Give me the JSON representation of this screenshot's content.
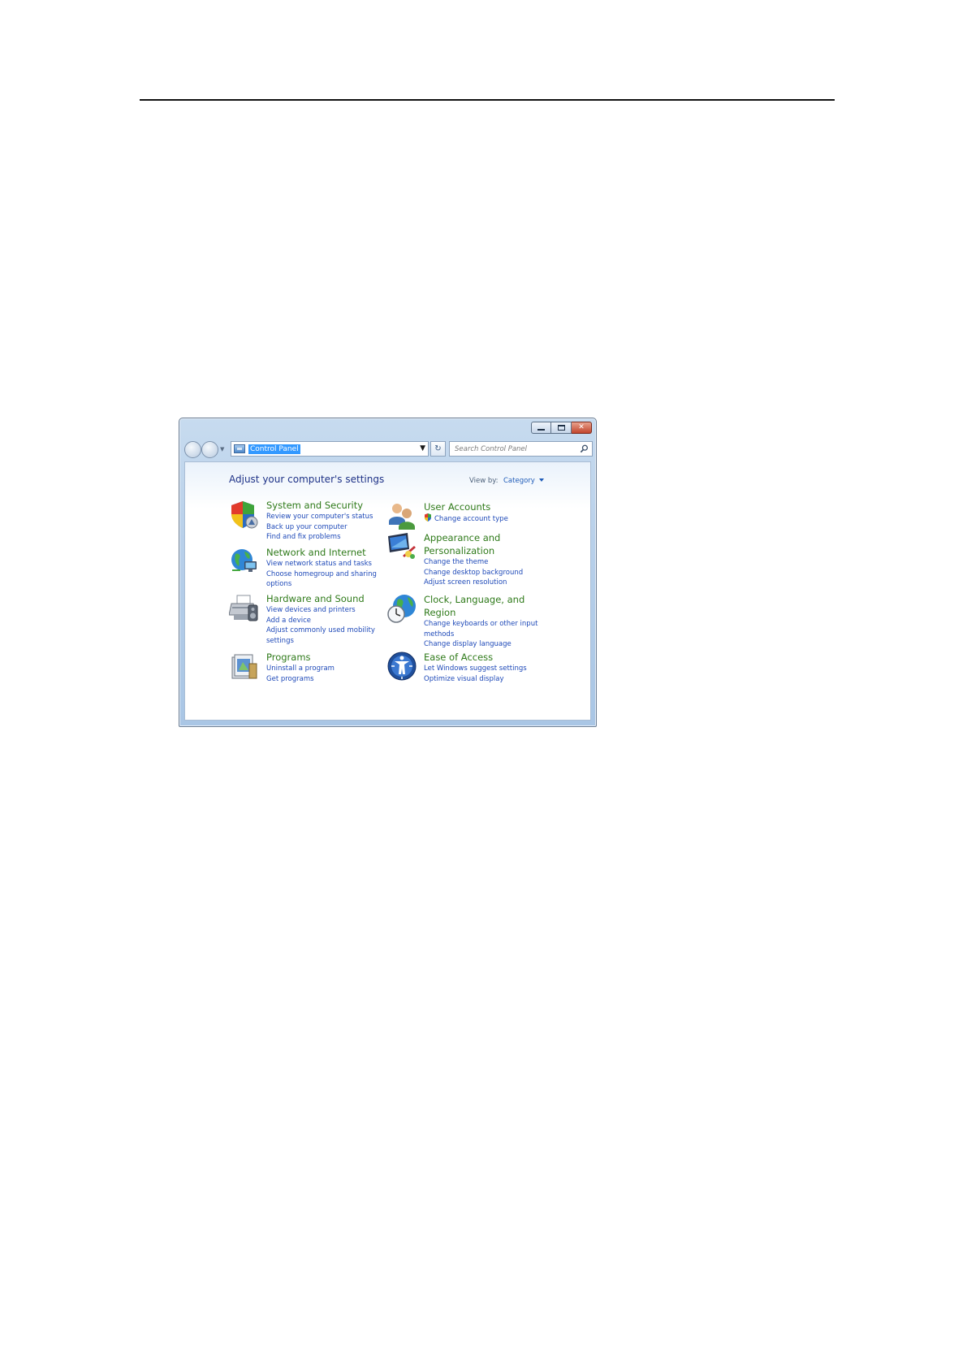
{
  "window": {
    "address": "Control Panel",
    "search_placeholder": "Search Control Panel",
    "refresh_glyph": "↻",
    "close_glyph": "✕"
  },
  "content": {
    "title": "Adjust your computer's settings",
    "viewby_label": "View by:",
    "viewby_value": "Category"
  },
  "categories": {
    "system_security": {
      "title": "System and Security",
      "links": [
        "Review your computer's status",
        "Back up your computer",
        "Find and fix problems"
      ],
      "icon": "shield-icon"
    },
    "network_internet": {
      "title": "Network and Internet",
      "links": [
        "View network status and tasks",
        "Choose homegroup and sharing options"
      ],
      "icon": "network-globe-icon"
    },
    "hardware_sound": {
      "title": "Hardware and Sound",
      "links": [
        "View devices and printers",
        "Add a device",
        "Adjust commonly used mobility settings"
      ],
      "icon": "printer-speaker-icon"
    },
    "programs": {
      "title": "Programs",
      "links": [
        "Uninstall a program",
        "Get programs"
      ],
      "icon": "programs-icon"
    },
    "user_accounts": {
      "title": "User Accounts",
      "links": [
        "Change account type"
      ],
      "icon": "users-icon"
    },
    "appearance": {
      "title": "Appearance and Personalization",
      "links": [
        "Change the theme",
        "Change desktop background",
        "Adjust screen resolution"
      ],
      "icon": "monitor-palette-icon"
    },
    "clock_language": {
      "title": "Clock, Language, and Region",
      "links": [
        "Change keyboards or other input methods",
        "Change display language"
      ],
      "icon": "clock-globe-icon"
    },
    "ease_access": {
      "title": "Ease of Access",
      "links": [
        "Let Windows suggest settings",
        "Optimize visual display"
      ],
      "icon": "ease-of-access-icon"
    }
  }
}
